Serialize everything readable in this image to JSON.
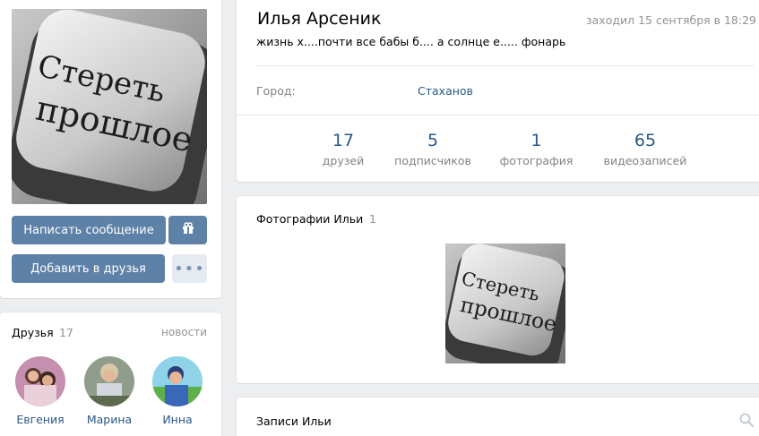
{
  "profile": {
    "name": "Илья Арсеник",
    "last_seen": "заходил 15 сентября в 18:29",
    "status": "жизнь х....почти все бабы б.... а солнце е..... фонарь",
    "city_label": "Город:",
    "city_value": "Стаханов",
    "avatar_text_line1": "Стереть",
    "avatar_text_line2": "прошлое"
  },
  "counters": [
    {
      "value": "17",
      "label": "друзей"
    },
    {
      "value": "5",
      "label": "подписчиков"
    },
    {
      "value": "1",
      "label": "фотография"
    },
    {
      "value": "65",
      "label": "видеозаписей"
    }
  ],
  "actions": {
    "message_label": "Написать сообщение",
    "add_friend_label": "Добавить в друзья",
    "more_label": "•••"
  },
  "friends": {
    "title": "Друзья",
    "count": "17",
    "news_link": "новости",
    "items": [
      {
        "name": "Евгения"
      },
      {
        "name": "Марина"
      },
      {
        "name": "Инна"
      }
    ]
  },
  "photos": {
    "title": "Фотографии Ильи",
    "count": "1"
  },
  "posts": {
    "title": "Записи Ильи"
  },
  "colors": {
    "accent": "#5e81a8",
    "link": "#2a5885",
    "background": "#edeef0"
  },
  "icons": {
    "gift": "gift-icon",
    "search": "search-icon"
  }
}
